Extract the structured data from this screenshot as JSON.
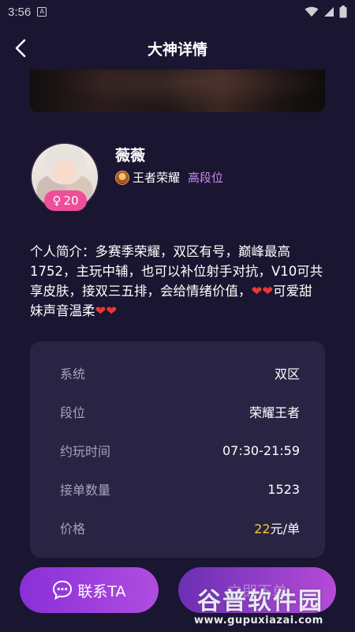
{
  "status_bar": {
    "time": "3:56",
    "a_icon": "A"
  },
  "header": {
    "title": "大神详情"
  },
  "profile": {
    "nickname": "薇薇",
    "gender_symbol": "♀",
    "age": "20",
    "game": "王者荣耀",
    "rank_tag": "高段位"
  },
  "intro": {
    "text": "个人简介：多赛季荣耀，双区有号，巅峰最高1752，主玩中辅，也可以补位射手对抗，V10可共享皮肤，接双三五排，会给情绪价值，",
    "hearts_1": "❤❤",
    "text2": "可爱甜妹声音温柔",
    "hearts_2": "❤❤"
  },
  "info": {
    "rows": [
      {
        "label": "系统",
        "value": "双区"
      },
      {
        "label": "段位",
        "value": "荣耀王者"
      },
      {
        "label": "约玩时间",
        "value": "07:30-21:59"
      },
      {
        "label": "接单数量",
        "value": "1523"
      }
    ],
    "price_label": "价格",
    "price_number": "22",
    "price_unit": "元/单"
  },
  "buttons": {
    "contact": "联系TA",
    "order": "立即下单"
  },
  "watermark": {
    "main": "谷普软件园",
    "url": "www.gupuxiazai.com"
  },
  "colors": {
    "background": "#1a1530",
    "card": "#2a2444",
    "accent": "#b04de0",
    "price": "#f6c928",
    "gender_badge": "#ee4f9a",
    "rank_tag": "#c58cf0"
  }
}
